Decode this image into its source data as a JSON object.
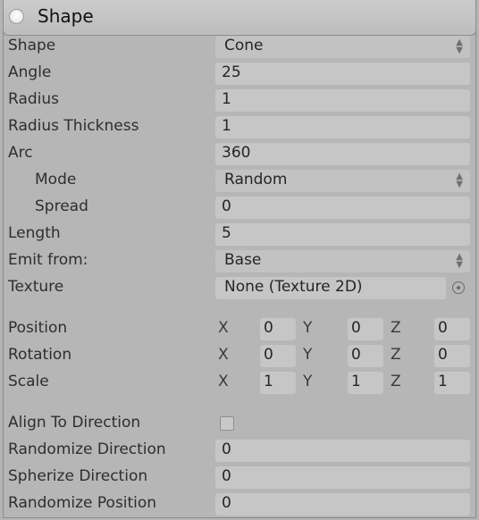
{
  "header": {
    "title": "Shape"
  },
  "rows": {
    "shape": {
      "label": "Shape",
      "value": "Cone"
    },
    "angle": {
      "label": "Angle",
      "value": "25"
    },
    "radius": {
      "label": "Radius",
      "value": "1"
    },
    "radius_thickness": {
      "label": "Radius Thickness",
      "value": "1"
    },
    "arc": {
      "label": "Arc",
      "value": "360"
    },
    "mode": {
      "label": "Mode",
      "value": "Random"
    },
    "spread": {
      "label": "Spread",
      "value": "0"
    },
    "length": {
      "label": "Length",
      "value": "5"
    },
    "emit_from": {
      "label": "Emit from:",
      "value": "Base"
    },
    "texture": {
      "label": "Texture",
      "value": "None (Texture 2D)"
    },
    "align": {
      "label": "Align To Direction",
      "checked": false
    },
    "randomize_direction": {
      "label": "Randomize Direction",
      "value": "0"
    },
    "spherize_direction": {
      "label": "Spherize Direction",
      "value": "0"
    },
    "randomize_position": {
      "label": "Randomize Position",
      "value": "0"
    }
  },
  "axes": {
    "x": "X",
    "y": "Y",
    "z": "Z"
  },
  "transform": {
    "position": {
      "label": "Position",
      "x": "0",
      "y": "0",
      "z": "0"
    },
    "rotation": {
      "label": "Rotation",
      "x": "0",
      "y": "0",
      "z": "0"
    },
    "scale": {
      "label": "Scale",
      "x": "1",
      "y": "1",
      "z": "1"
    }
  },
  "icons": {
    "dropdown": "up-down-arrows-icon",
    "object_picker": "object-picker-icon",
    "module_toggle": "module-toggle-icon"
  }
}
